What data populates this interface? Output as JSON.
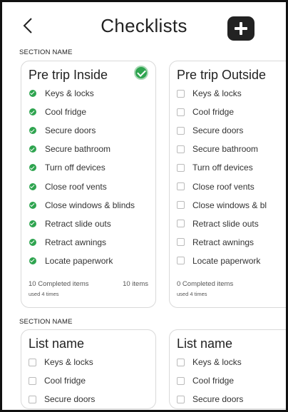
{
  "header": {
    "title": "Checklists",
    "back_icon": "chevron-left-icon",
    "add_icon": "plus-icon"
  },
  "sections": [
    {
      "label": "SECTION NAME",
      "cards": [
        {
          "title": "Pre trip Inside",
          "completed_check": true,
          "items": [
            {
              "label": "Keys & locks",
              "checked": true
            },
            {
              "label": "Cool fridge",
              "checked": true
            },
            {
              "label": "Secure doors",
              "checked": true
            },
            {
              "label": "Secure bathroom",
              "checked": true
            },
            {
              "label": "Turn off devices",
              "checked": true
            },
            {
              "label": "Close roof vents",
              "checked": true
            },
            {
              "label": "Close windows & blinds",
              "checked": true
            },
            {
              "label": "Retract slide outs",
              "checked": true
            },
            {
              "label": "Retract awnings",
              "checked": true
            },
            {
              "label": "Locate paperwork",
              "checked": true
            }
          ],
          "completed_text": "10 Completed items",
          "count_text": "10 items",
          "used_text": "used 4 times"
        },
        {
          "title": "Pre trip Outside",
          "completed_check": false,
          "items": [
            {
              "label": "Keys & locks",
              "checked": false
            },
            {
              "label": "Cool fridge",
              "checked": false
            },
            {
              "label": "Secure doors",
              "checked": false
            },
            {
              "label": "Secure bathroom",
              "checked": false
            },
            {
              "label": "Turn off devices",
              "checked": false
            },
            {
              "label": "Close roof vents",
              "checked": false
            },
            {
              "label": "Close windows & bl",
              "checked": false
            },
            {
              "label": "Retract slide outs",
              "checked": false
            },
            {
              "label": "Retract awnings",
              "checked": false
            },
            {
              "label": "Locate paperwork",
              "checked": false
            }
          ],
          "completed_text": "0 Completed items",
          "count_text": "",
          "used_text": "used 4 times"
        }
      ]
    },
    {
      "label": "SECTION NAME",
      "cards": [
        {
          "title": "List name",
          "completed_check": false,
          "items": [
            {
              "label": "Keys & locks",
              "checked": false
            },
            {
              "label": "Cool fridge",
              "checked": false
            },
            {
              "label": "Secure doors",
              "checked": false
            }
          ],
          "completed_text": "",
          "count_text": "",
          "used_text": ""
        },
        {
          "title": "List name",
          "completed_check": false,
          "items": [
            {
              "label": "Keys & locks",
              "checked": false
            },
            {
              "label": "Cool fridge",
              "checked": false
            },
            {
              "label": "Secure doors",
              "checked": false
            }
          ],
          "completed_text": "",
          "count_text": "",
          "used_text": ""
        }
      ]
    }
  ],
  "colors": {
    "check_green": "#2ea44f",
    "add_button": "#222222",
    "card_border": "#d9d9d9"
  }
}
